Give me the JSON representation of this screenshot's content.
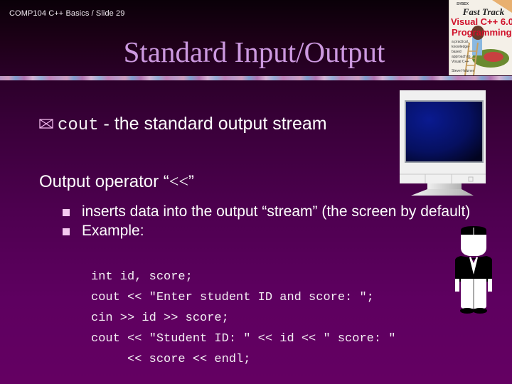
{
  "header": {
    "slide_label": "COMP104 C++ Basics / Slide 29",
    "title": "Standard Input/Output"
  },
  "book_cover": {
    "publisher": "SYBEX",
    "title_line1": "Fast Track",
    "title_line2": "Visual C++ 6.0",
    "title_line3": "Programming",
    "blurb": "a practical, knowledge-based approach to Visual C++",
    "author": "Steve Holzner"
  },
  "body": {
    "point1": {
      "icon": "envelope-x-bullet",
      "keyword": "cout",
      "text": " - the standard output stream"
    },
    "point2": {
      "text": "Output operator ",
      "open_quote": "“",
      "operator": "<<",
      "close_quote": "”"
    },
    "subpoints": [
      {
        "icon": "square-bullet",
        "text": "inserts data into the output “stream” (the screen by default)"
      },
      {
        "icon": "square-bullet",
        "text": "Example:"
      }
    ],
    "code_lines": [
      "int id, score;",
      "cout << \"Enter student ID and score: \";",
      "cin >> id >> score;",
      "cout << \"Student ID: \" << id << \" score: \"",
      "     << score << endl;"
    ]
  },
  "illustrations": {
    "monitor": "computer-monitor-icon",
    "person": "waiter-figure"
  },
  "colors": {
    "title": "#cc99e0",
    "bullet_square": "#f4c8f0",
    "background_top": "#0a0008",
    "background_bottom": "#640062",
    "monitor_screen": "#0a1a80"
  }
}
